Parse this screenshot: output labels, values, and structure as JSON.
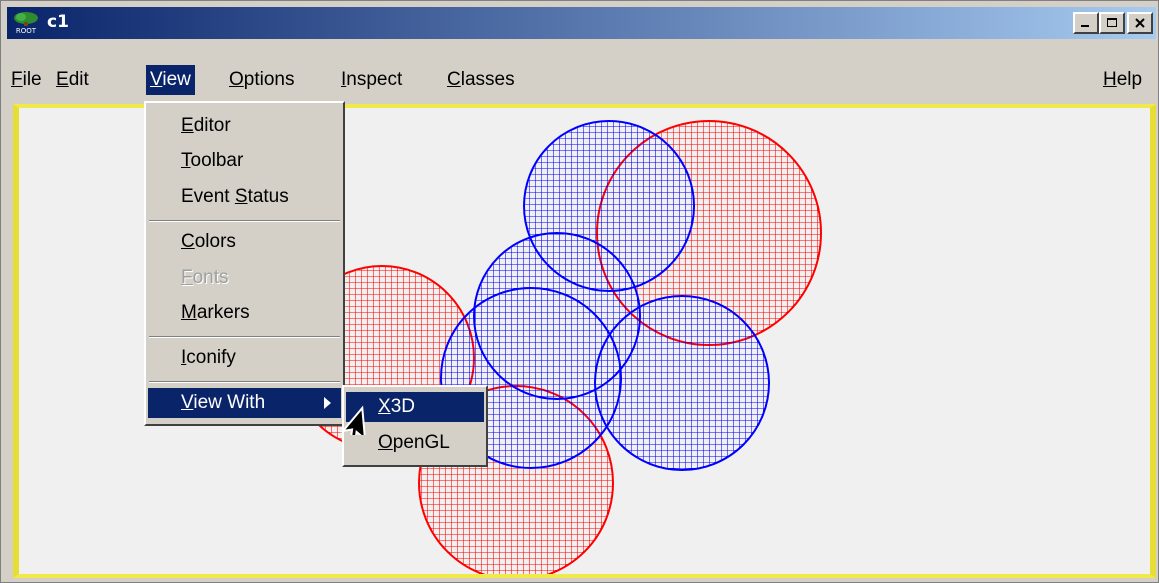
{
  "window": {
    "title": "c1",
    "icon": "root-tree-icon",
    "icon_text": "ROOT"
  },
  "menubar": {
    "items": [
      {
        "name": "File",
        "mn": "F",
        "rest": "ile"
      },
      {
        "name": "Edit",
        "mn": "E",
        "rest": "dit"
      },
      {
        "name": "View",
        "mn": "V",
        "rest": "iew"
      },
      {
        "name": "Options",
        "mn": "O",
        "rest": "ptions"
      },
      {
        "name": "Inspect",
        "mn": "I",
        "rest": "nspect"
      },
      {
        "name": "Classes",
        "mn": "C",
        "rest": "lasses"
      }
    ],
    "help": {
      "name": "Help",
      "mn": "H",
      "rest": "elp"
    }
  },
  "view_menu": {
    "editor": {
      "pre": "",
      "mn": "E",
      "rest": "ditor"
    },
    "toolbar": {
      "pre": "",
      "mn": "T",
      "rest": "oolbar"
    },
    "event_status": {
      "pre": "Event ",
      "mn": "S",
      "rest": "tatus"
    },
    "colors": {
      "pre": "",
      "mn": "C",
      "rest": "olors"
    },
    "fonts": {
      "pre": "",
      "mn": "F",
      "rest": "onts"
    },
    "markers": {
      "pre": "",
      "mn": "M",
      "rest": "arkers"
    },
    "iconify": {
      "pre": "",
      "mn": "I",
      "rest": "conify"
    },
    "view_with": {
      "pre": "",
      "mn": "V",
      "rest": "iew With"
    }
  },
  "view_with_menu": {
    "x3d": {
      "pre": "",
      "mn": "X",
      "rest": "3D"
    },
    "opengl": {
      "pre": "",
      "mn": "O",
      "rest": "penGL"
    }
  },
  "colors": {
    "selection": "#0a246a",
    "canvas_border": "#f0e94a",
    "red_sphere": "#ff0000",
    "blue_sphere": "#0000ff"
  }
}
